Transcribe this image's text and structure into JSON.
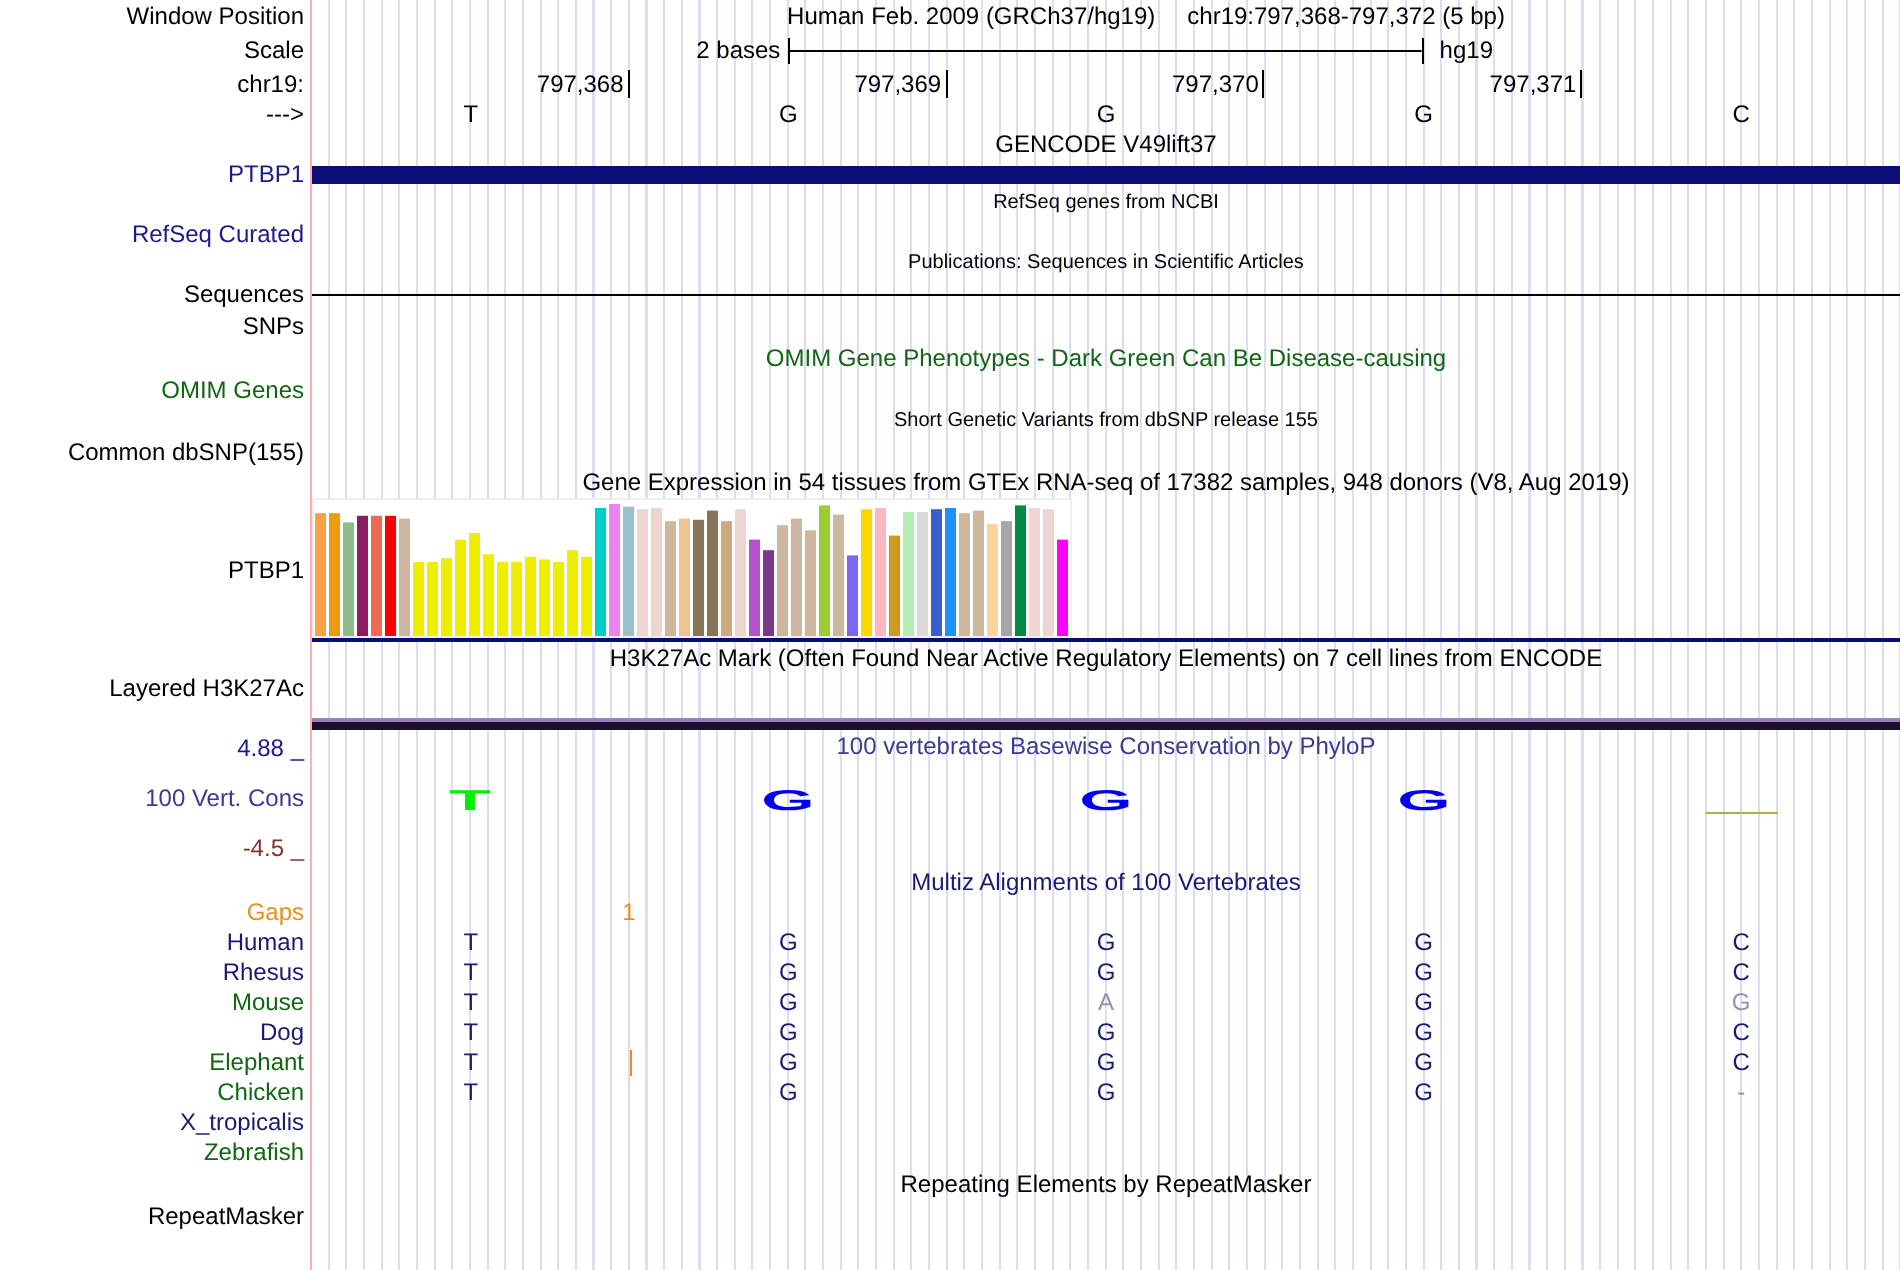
{
  "header": {
    "label": "Window Position",
    "title": "Human Feb. 2009 (GRCh37/hg19)",
    "position": "chr19:797,368-797,372 (5 bp)"
  },
  "scale": {
    "label": "Scale",
    "text": "2 bases",
    "assembly": "hg19"
  },
  "ruler": {
    "label": "chr19:",
    "ticks": [
      "797,368",
      "797,369",
      "797,370",
      "797,371"
    ]
  },
  "bases": {
    "label": "--->",
    "values": [
      "T",
      "G",
      "G",
      "G",
      "C"
    ]
  },
  "tracks": [
    {
      "kind": "gene",
      "title": "GENCODE V49lift37",
      "label": "PTBP1",
      "color": "#1a1a8c"
    },
    {
      "kind": "compact",
      "title": "RefSeq genes from NCBI",
      "label": "RefSeq Curated",
      "color": "#1a1a8c"
    },
    {
      "kind": "compact",
      "title": "Publications: Sequences in Scientific Articles"
    },
    {
      "kind": "line",
      "label": "Sequences",
      "color": "#000000"
    },
    {
      "kind": "empty",
      "label": "SNPs",
      "color": "#000000"
    },
    {
      "kind": "empty",
      "title": "OMIM Gene Phenotypes - Dark Green Can Be Disease-causing",
      "label": "OMIM Genes",
      "color": "#116611"
    },
    {
      "kind": "compact",
      "title": "Short Genetic Variants from dbSNP release 155",
      "label": "Common dbSNP(155)",
      "color": "#000000"
    },
    {
      "kind": "expression",
      "title": "Gene Expression in 54 tissues from GTEx RNA-seq of 17382 samples, 948 donors (V8, Aug 2019)",
      "label": "PTBP1",
      "color": "#000000"
    },
    {
      "kind": "layered",
      "title": "H3K27Ac Mark (Often Found Near Active Regulatory Elements) on 7 cell lines from ENCODE",
      "label": "Layered H3K27Ac",
      "color": "#000000"
    },
    {
      "kind": "conservation",
      "title": "100 vertebrates Basewise Conservation by PhyloP",
      "label": "100 Vert. Cons",
      "color": "#3a3a90",
      "max": "4.88 _",
      "min": "-4.5 _",
      "letters": [
        {
          "text": "T",
          "color": "#00ee00"
        },
        {
          "text": "G",
          "color": "#0000ee"
        },
        {
          "text": "G",
          "color": "#0000ee"
        },
        {
          "text": "G",
          "color": "#0000ee"
        }
      ]
    },
    {
      "kind": "alignment",
      "title": "Multiz Alignments of 100 Vertebrates",
      "color": "#1a1a70",
      "rows": [
        {
          "kind": "gaps",
          "label": "Gaps",
          "color": "#e8901a",
          "mark": "1"
        },
        {
          "kind": "species",
          "label": "Human",
          "color": "#1a1a70",
          "bases": [
            "T",
            "G",
            "G",
            "G",
            "C"
          ],
          "differs": [
            false,
            false,
            false,
            false,
            false
          ]
        },
        {
          "kind": "species",
          "label": "Rhesus",
          "color": "#1a1a70",
          "bases": [
            "T",
            "G",
            "G",
            "G",
            "C"
          ],
          "differs": [
            false,
            false,
            false,
            false,
            false
          ]
        },
        {
          "kind": "species",
          "label": "Mouse",
          "color": "#116611",
          "bases": [
            "T",
            "G",
            "A",
            "G",
            "G"
          ],
          "differs": [
            false,
            false,
            true,
            false,
            true
          ]
        },
        {
          "kind": "species",
          "label": "Dog",
          "color": "#1a1a70",
          "bases": [
            "T",
            "G",
            "G",
            "G",
            "C"
          ],
          "differs": [
            false,
            false,
            false,
            false,
            false
          ]
        },
        {
          "kind": "species",
          "label": "Elephant",
          "color": "#116611",
          "insertion": true,
          "bases": [
            "T",
            "G",
            "G",
            "G",
            "C"
          ],
          "differs": [
            false,
            false,
            false,
            false,
            false
          ]
        },
        {
          "kind": "species",
          "label": "Chicken",
          "color": "#116611",
          "bases": [
            "T",
            "G",
            "G",
            "G",
            "-"
          ],
          "differs": [
            false,
            false,
            false,
            false,
            true
          ]
        },
        {
          "kind": "species",
          "label": "X_tropicalis",
          "color": "#1a1a70"
        },
        {
          "kind": "species",
          "label": "Zebrafish",
          "color": "#116611"
        }
      ]
    },
    {
      "kind": "empty",
      "title": "Repeating Elements by RepeatMasker",
      "label": "RepeatMasker",
      "color": "#000000"
    }
  ]
}
